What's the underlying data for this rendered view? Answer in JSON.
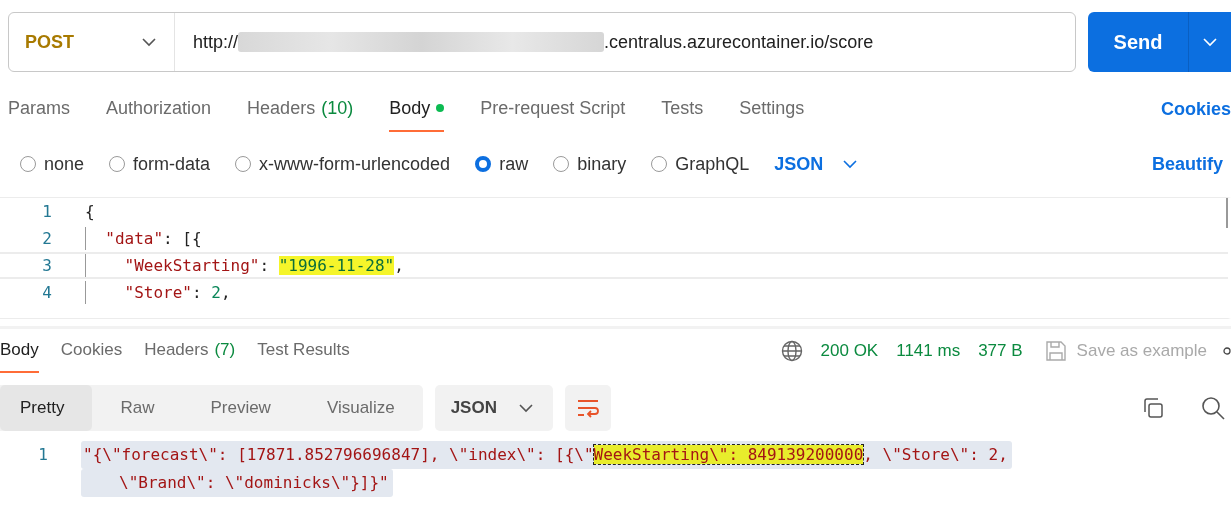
{
  "request": {
    "method": "POST",
    "url_prefix": "http://",
    "url_suffix": ".centralus.azurecontainer.io/score",
    "send_label": "Send"
  },
  "request_tabs": [
    {
      "label": "Params",
      "selected": false
    },
    {
      "label": "Authorization",
      "selected": false
    },
    {
      "label": "Headers",
      "count": "(10)",
      "selected": false
    },
    {
      "label": "Body",
      "selected": true,
      "dot": true
    },
    {
      "label": "Pre-request Script",
      "selected": false
    },
    {
      "label": "Tests",
      "selected": false
    },
    {
      "label": "Settings",
      "selected": false
    }
  ],
  "cookies_link": "Cookies",
  "body_types": [
    {
      "label": "none",
      "selected": false
    },
    {
      "label": "form-data",
      "selected": false
    },
    {
      "label": "x-www-form-urlencoded",
      "selected": false
    },
    {
      "label": "raw",
      "selected": true
    },
    {
      "label": "binary",
      "selected": false
    },
    {
      "label": "GraphQL",
      "selected": false
    }
  ],
  "body_format": "JSON",
  "beautify_link": "Beautify",
  "request_editor": {
    "lines": [
      {
        "number": "1",
        "current": false,
        "segments": [
          {
            "kind": "punct",
            "text": "{",
            "highlighted": false
          }
        ]
      },
      {
        "number": "2",
        "current": false,
        "segments": [
          {
            "kind": "key",
            "text": "  \"data\"",
            "highlighted": false
          },
          {
            "kind": "punct",
            "text": ": [{",
            "highlighted": false
          }
        ]
      },
      {
        "number": "3",
        "current": true,
        "segments": [
          {
            "kind": "key",
            "text": "    \"WeekStarting\"",
            "highlighted": false
          },
          {
            "kind": "punct",
            "text": ": ",
            "highlighted": false
          },
          {
            "kind": "string",
            "text": "\"1996-11-28\"",
            "highlighted": true
          },
          {
            "kind": "punct",
            "text": ",",
            "highlighted": false
          }
        ]
      },
      {
        "number": "4",
        "current": false,
        "segments": [
          {
            "kind": "key",
            "text": "    \"Store\"",
            "highlighted": false
          },
          {
            "kind": "punct",
            "text": ": ",
            "highlighted": false
          },
          {
            "kind": "number",
            "text": "2",
            "highlighted": false
          },
          {
            "kind": "punct",
            "text": ",",
            "highlighted": false
          }
        ]
      }
    ]
  },
  "response_tabs": [
    {
      "label": "Body",
      "selected": true
    },
    {
      "label": "Cookies",
      "selected": false
    },
    {
      "label": "Headers",
      "count": "(7)",
      "selected": false
    },
    {
      "label": "Test Results",
      "selected": false
    }
  ],
  "response_status": {
    "status": "200 OK",
    "time": "1141 ms",
    "size": "377 B",
    "save_label": "Save as example"
  },
  "view_modes": [
    {
      "label": "Pretty",
      "selected": true
    },
    {
      "label": "Raw",
      "selected": false
    },
    {
      "label": "Preview",
      "selected": false
    },
    {
      "label": "Visualize",
      "selected": false
    }
  ],
  "response_format": "JSON",
  "response_body": {
    "number": "1",
    "selected": true,
    "rows": [
      [
        {
          "text": "\"{\\\"forecast\\\": [17871.852796696847], \\\"index\\\": [{\\\"",
          "highlighted": false
        },
        {
          "text": "WeekStarting\\\": 849139200000",
          "highlighted": true
        },
        {
          "text": ", \\\"Store\\\": 2,",
          "highlighted": false
        }
      ],
      [
        {
          "text": "\\\"Brand\\\": \\\"dominicks\\\"}]}\"",
          "highlighted": false
        }
      ]
    ]
  }
}
